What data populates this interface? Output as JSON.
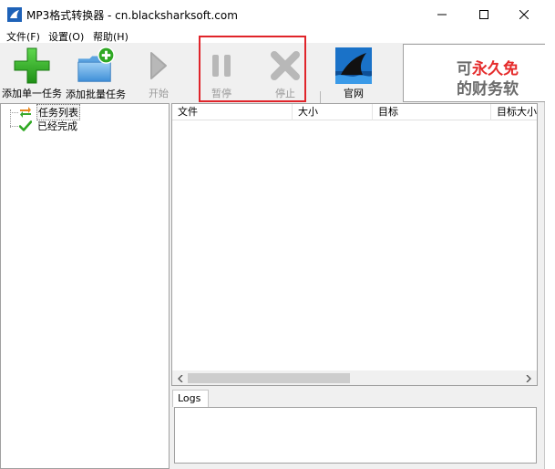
{
  "window": {
    "title": "MP3格式转换器 - cn.blacksharksoft.com"
  },
  "menu": {
    "file": "文件(F)",
    "settings": "设置(O)",
    "help": "帮助(H)"
  },
  "toolbar": {
    "add_single": "添加单一任务",
    "add_batch": "添加批量任务",
    "start": "开始",
    "pause": "暂停",
    "stop": "停止",
    "website": "官网"
  },
  "ad": {
    "line1_gray": "可",
    "line1_red": "永久免",
    "line2": "的财务软"
  },
  "tree": {
    "items": [
      {
        "label": "任务列表",
        "icon": "swap-arrows-icon"
      },
      {
        "label": "已经完成",
        "icon": "checkmark-icon"
      }
    ]
  },
  "list": {
    "columns": [
      "文件",
      "大小",
      "目标",
      "目标大小"
    ]
  },
  "logs": {
    "tab_label": "Logs"
  },
  "colors": {
    "accent_green": "#2fa823",
    "highlight_red": "#e0242a",
    "disabled_gray": "#9a9a9a"
  }
}
